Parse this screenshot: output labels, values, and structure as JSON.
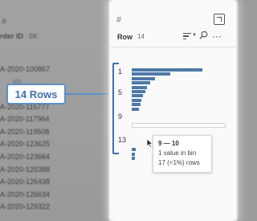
{
  "left_panel": {
    "hash": "#",
    "header": "rder ID",
    "count": "5K",
    "ids": [
      "A-2020-100867",
      "A-2020-115777",
      "A-2020-117964",
      "A-2020-119508",
      "A-2020-123625",
      "A-2020-123664",
      "A-2020-125388",
      "A-2020-126438",
      "A-2020-126634",
      "A-2020-129322"
    ]
  },
  "callout": {
    "label": "14 Rows"
  },
  "card": {
    "hash": "#",
    "title": "Row",
    "count": "14",
    "bin_labels": [
      "1",
      "5",
      "9",
      "13"
    ],
    "bar_values": [
      1,
      0.55,
      0.33,
      0.26,
      0.22,
      0.19,
      0.16,
      0.14,
      0.12,
      0.1,
      0,
      0.06,
      0.05,
      0.04
    ]
  },
  "tooltip": {
    "range": "9 — 10",
    "line1": "1 value in bin",
    "line2": "17 (<1%) rows"
  },
  "colors": {
    "accent": "#3f70ad",
    "bar": "#4e79a7",
    "card_bg": "#fafafa"
  }
}
